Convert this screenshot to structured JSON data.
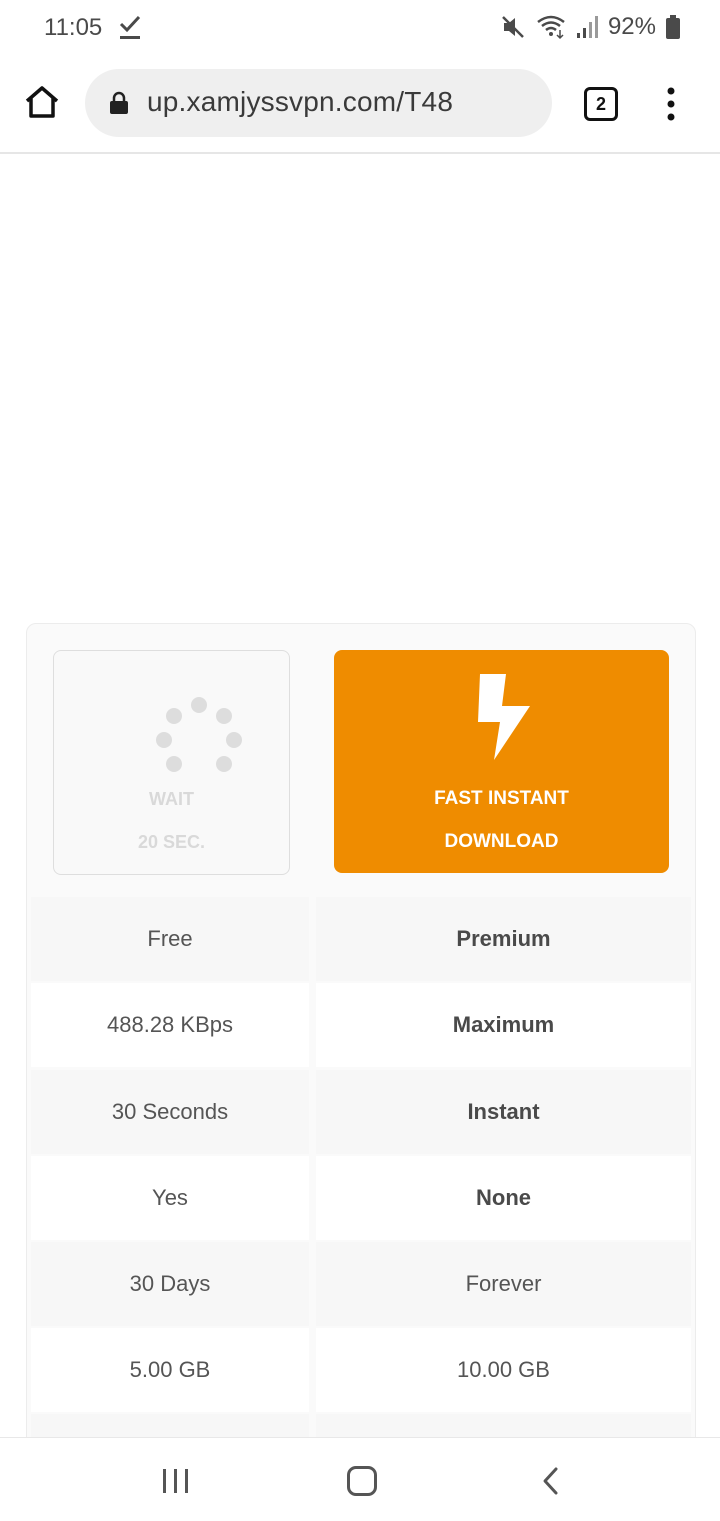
{
  "status_bar": {
    "time": "11:05",
    "battery": "92%"
  },
  "browser": {
    "url": "up.xamjyssvpn.com/T48",
    "tab_count": "2"
  },
  "download_panel": {
    "wait_line1": "WAIT",
    "wait_line2": "20 SEC.",
    "fast_line1": "FAST INSTANT",
    "fast_line2": "DOWNLOAD",
    "accent_color": "#ef8c00"
  },
  "comparison": {
    "rows": [
      {
        "free": "Free",
        "premium": "Premium"
      },
      {
        "free": "488.28 KBps",
        "premium": "Maximum"
      },
      {
        "free": "30 Seconds",
        "premium": "Instant"
      },
      {
        "free": "Yes",
        "premium": "None"
      },
      {
        "free": "30 Days",
        "premium": "Forever"
      },
      {
        "free": "5.00 GB",
        "premium": "10.00 GB"
      }
    ]
  }
}
